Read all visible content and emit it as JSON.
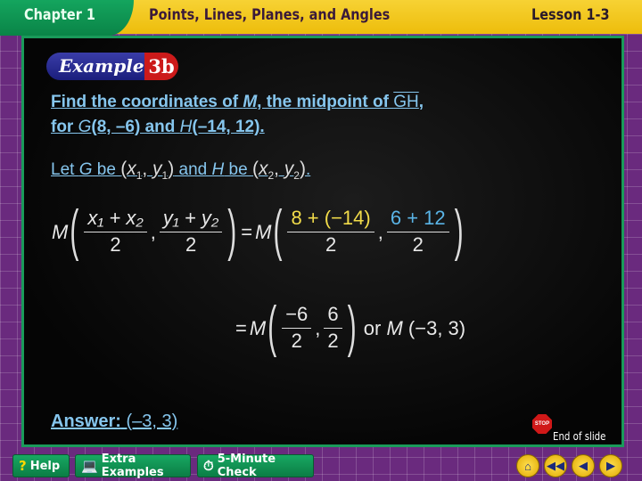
{
  "header": {
    "chapter": "Chapter 1",
    "title": "Points, Lines, Planes, and Angles",
    "lesson": "Lesson 1-3"
  },
  "badge": {
    "word": "Example",
    "number": "3b"
  },
  "question": {
    "line1_a": "Find the coordinates of ",
    "line1_m": "M",
    "line1_b": ", the midpoint of ",
    "line1_seg": "GH",
    "line1_c": ",",
    "line2_a": "for ",
    "line2_g": "G",
    "line2_b": "(8, –6) and ",
    "line2_h": "H",
    "line2_c": "(–14, 12)."
  },
  "let": {
    "a": "Let ",
    "g": "G",
    "b": " be ",
    "c": " and ",
    "h": "H",
    "d": " be ",
    "e": "."
  },
  "math": {
    "M": "M",
    "eq": "=",
    "x1x2": "x₁ + x₂",
    "y1y2": "y₁ + y₂",
    "two": "2",
    "num1": "8 + (−14)",
    "num2": "6 + 12",
    "n3": "−6",
    "n4": "6",
    "or": "or",
    "final": "(−3, 3)"
  },
  "answer": {
    "label": "Answer:",
    "value": " (–3, 3)"
  },
  "end_of_slide": "End of slide",
  "stop_text": "STOP",
  "buttons": {
    "help": "Help",
    "extra": "Extra Examples",
    "check": "5-Minute Check"
  },
  "colors": {
    "text": "#86c6ee",
    "yellow": "#f2dc4a",
    "blue": "#5ab4e6",
    "board_border": "#1a9a5a"
  }
}
